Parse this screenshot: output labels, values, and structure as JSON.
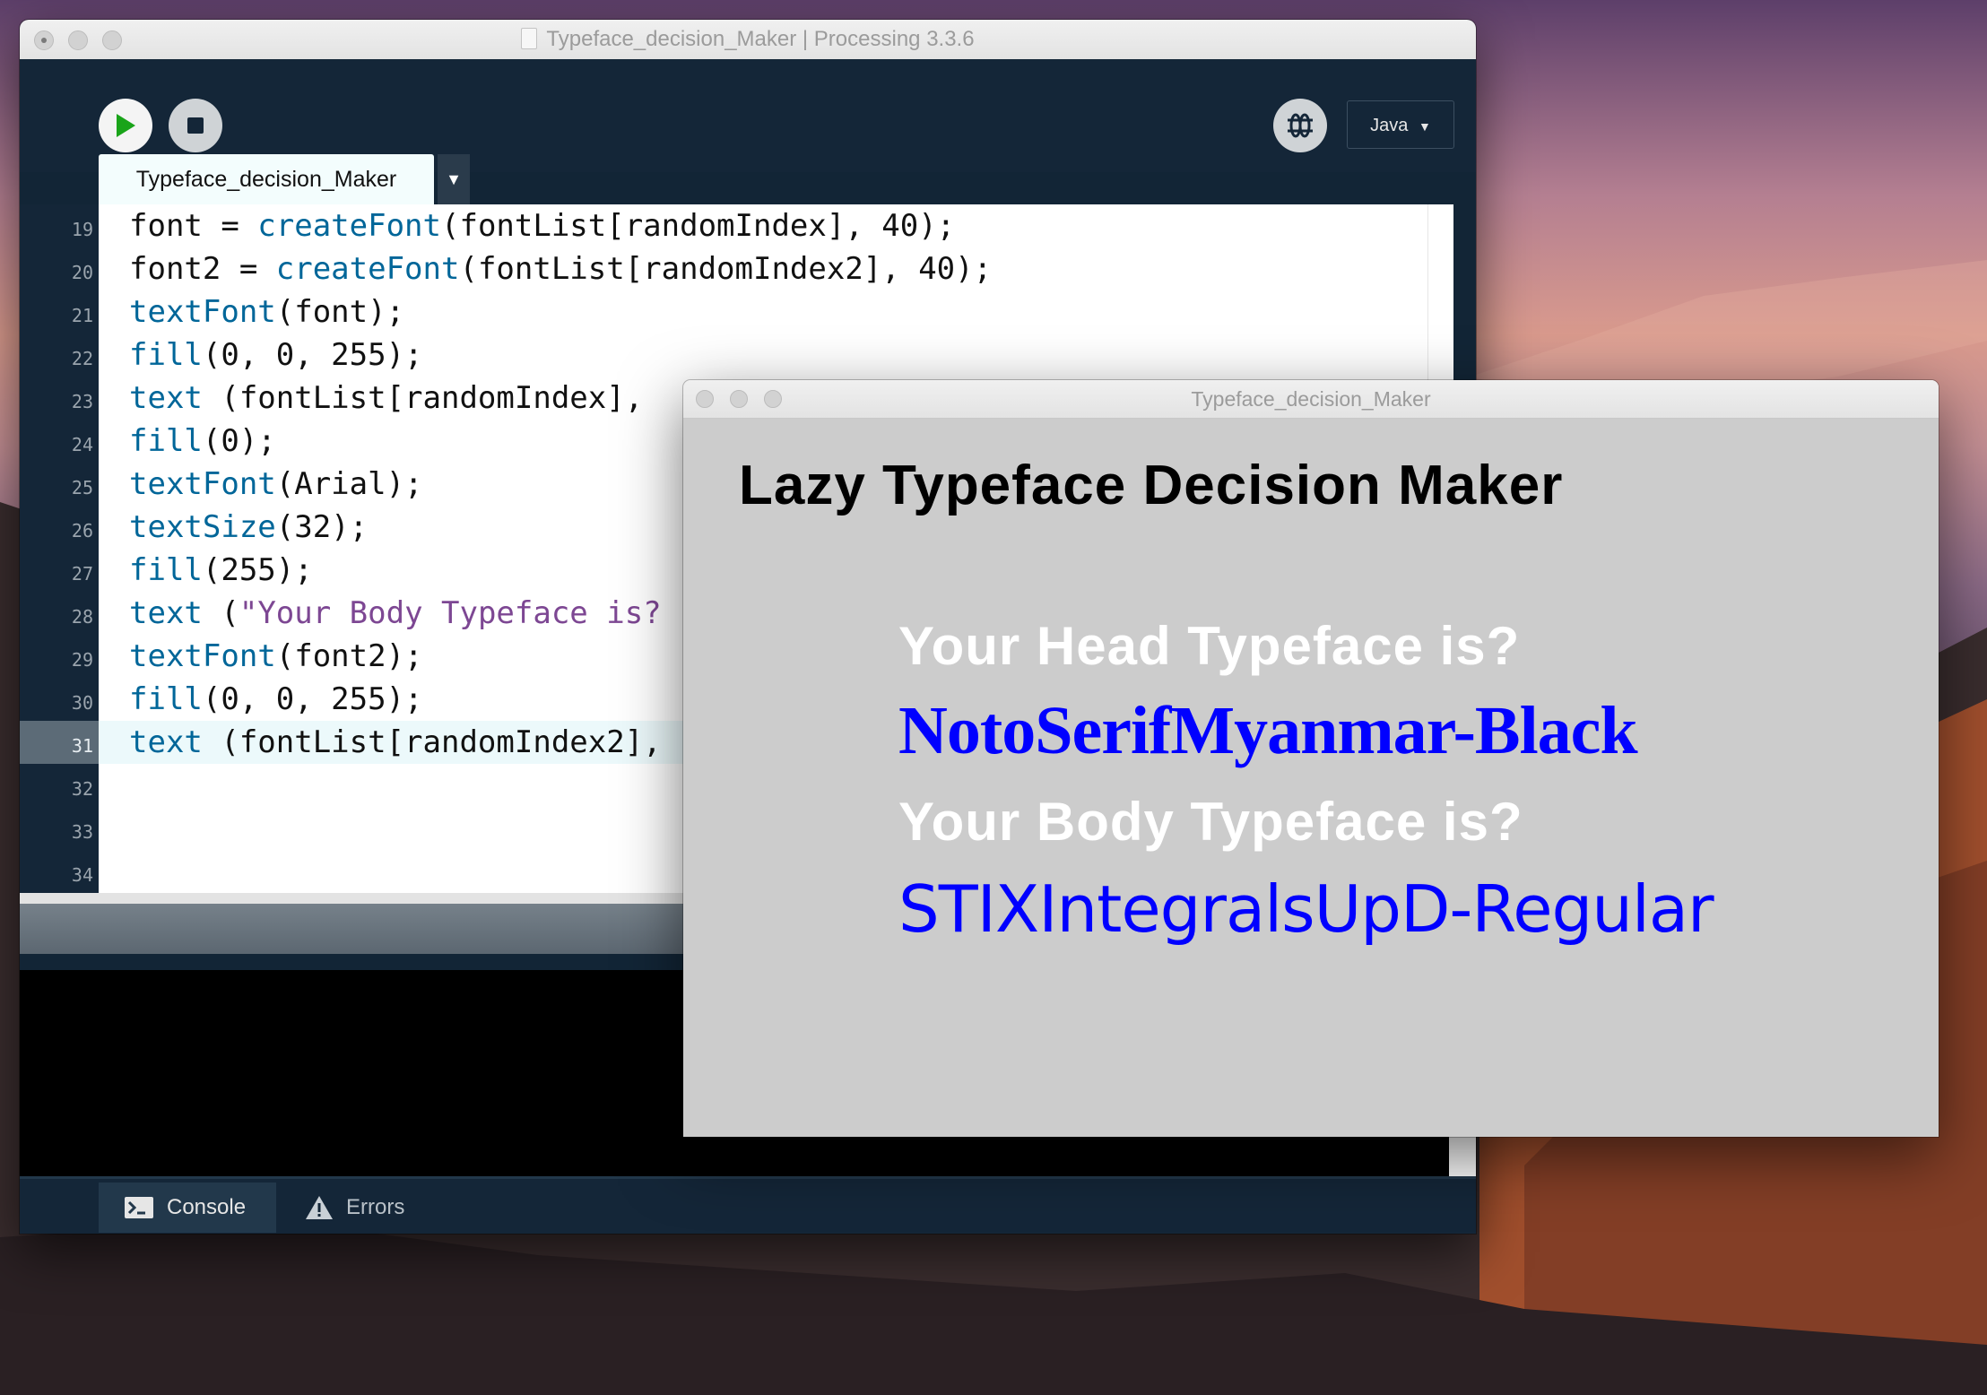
{
  "ide_window": {
    "title": "Typeface_decision_Maker | Processing 3.3.6",
    "mode": "Java",
    "tab_label": "Typeface_decision_Maker",
    "current_line": 31,
    "lines": [
      {
        "n": "19",
        "parts": [
          [
            "plain",
            "font = "
          ],
          [
            "fn",
            "createFont"
          ],
          [
            "plain",
            "(fontList[randomIndex], 40);"
          ]
        ]
      },
      {
        "n": "20",
        "parts": [
          [
            "plain",
            "font2 = "
          ],
          [
            "fn",
            "createFont"
          ],
          [
            "plain",
            "(fontList[randomIndex2], 40);"
          ]
        ]
      },
      {
        "n": "21",
        "parts": [
          [
            "fn",
            "textFont"
          ],
          [
            "plain",
            "(font);"
          ]
        ]
      },
      {
        "n": "22",
        "parts": [
          [
            "fn",
            "fill"
          ],
          [
            "plain",
            "(0, 0, 255);"
          ]
        ]
      },
      {
        "n": "23",
        "parts": [
          [
            "fn",
            "text"
          ],
          [
            "plain",
            " (fontList[randomIndex],"
          ]
        ]
      },
      {
        "n": "24",
        "parts": [
          [
            "fn",
            "fill"
          ],
          [
            "plain",
            "(0);"
          ]
        ]
      },
      {
        "n": "25",
        "parts": [
          [
            "fn",
            "textFont"
          ],
          [
            "plain",
            "(Arial);"
          ]
        ]
      },
      {
        "n": "26",
        "parts": [
          [
            "fn",
            "textSize"
          ],
          [
            "plain",
            "(32);"
          ]
        ]
      },
      {
        "n": "27",
        "parts": [
          [
            "fn",
            "fill"
          ],
          [
            "plain",
            "(255);"
          ]
        ]
      },
      {
        "n": "28",
        "parts": [
          [
            "fn",
            "text"
          ],
          [
            "plain",
            " ("
          ],
          [
            "str",
            "\"Your Body Typeface is?"
          ]
        ]
      },
      {
        "n": "29",
        "parts": [
          [
            "fn",
            "textFont"
          ],
          [
            "plain",
            "(font2);"
          ]
        ]
      },
      {
        "n": "30",
        "parts": [
          [
            "fn",
            "fill"
          ],
          [
            "plain",
            "(0, 0, 255);"
          ]
        ]
      },
      {
        "n": "31",
        "parts": [
          [
            "fn",
            "text"
          ],
          [
            "plain",
            " (fontList[randomIndex2],"
          ]
        ]
      },
      {
        "n": "32",
        "parts": []
      },
      {
        "n": "33",
        "parts": []
      },
      {
        "n": "34",
        "parts": []
      }
    ],
    "footer": {
      "console_label": "Console",
      "errors_label": "Errors"
    },
    "icons": {
      "run": "play-icon",
      "stop": "stop-icon",
      "debug": "debugger-icon",
      "console": "terminal-icon",
      "errors": "warning-icon"
    },
    "colors": {
      "accent_run": "#1aa41a",
      "keyword_fn": "#006699",
      "string": "#7d4793"
    }
  },
  "sketch_window": {
    "title": "Typeface_decision_Maker",
    "heading": "Lazy Typeface Decision Maker",
    "head_label": "Your Head Typeface is?",
    "head_value": "NotoSerifMyanmar-Black",
    "body_label": "Your Body Typeface is?",
    "body_value": "STIXIntegralsUpD-Regular",
    "colors": {
      "background": "#cccccc",
      "value_text": "#0000ff",
      "label_text": "#ffffff"
    }
  }
}
